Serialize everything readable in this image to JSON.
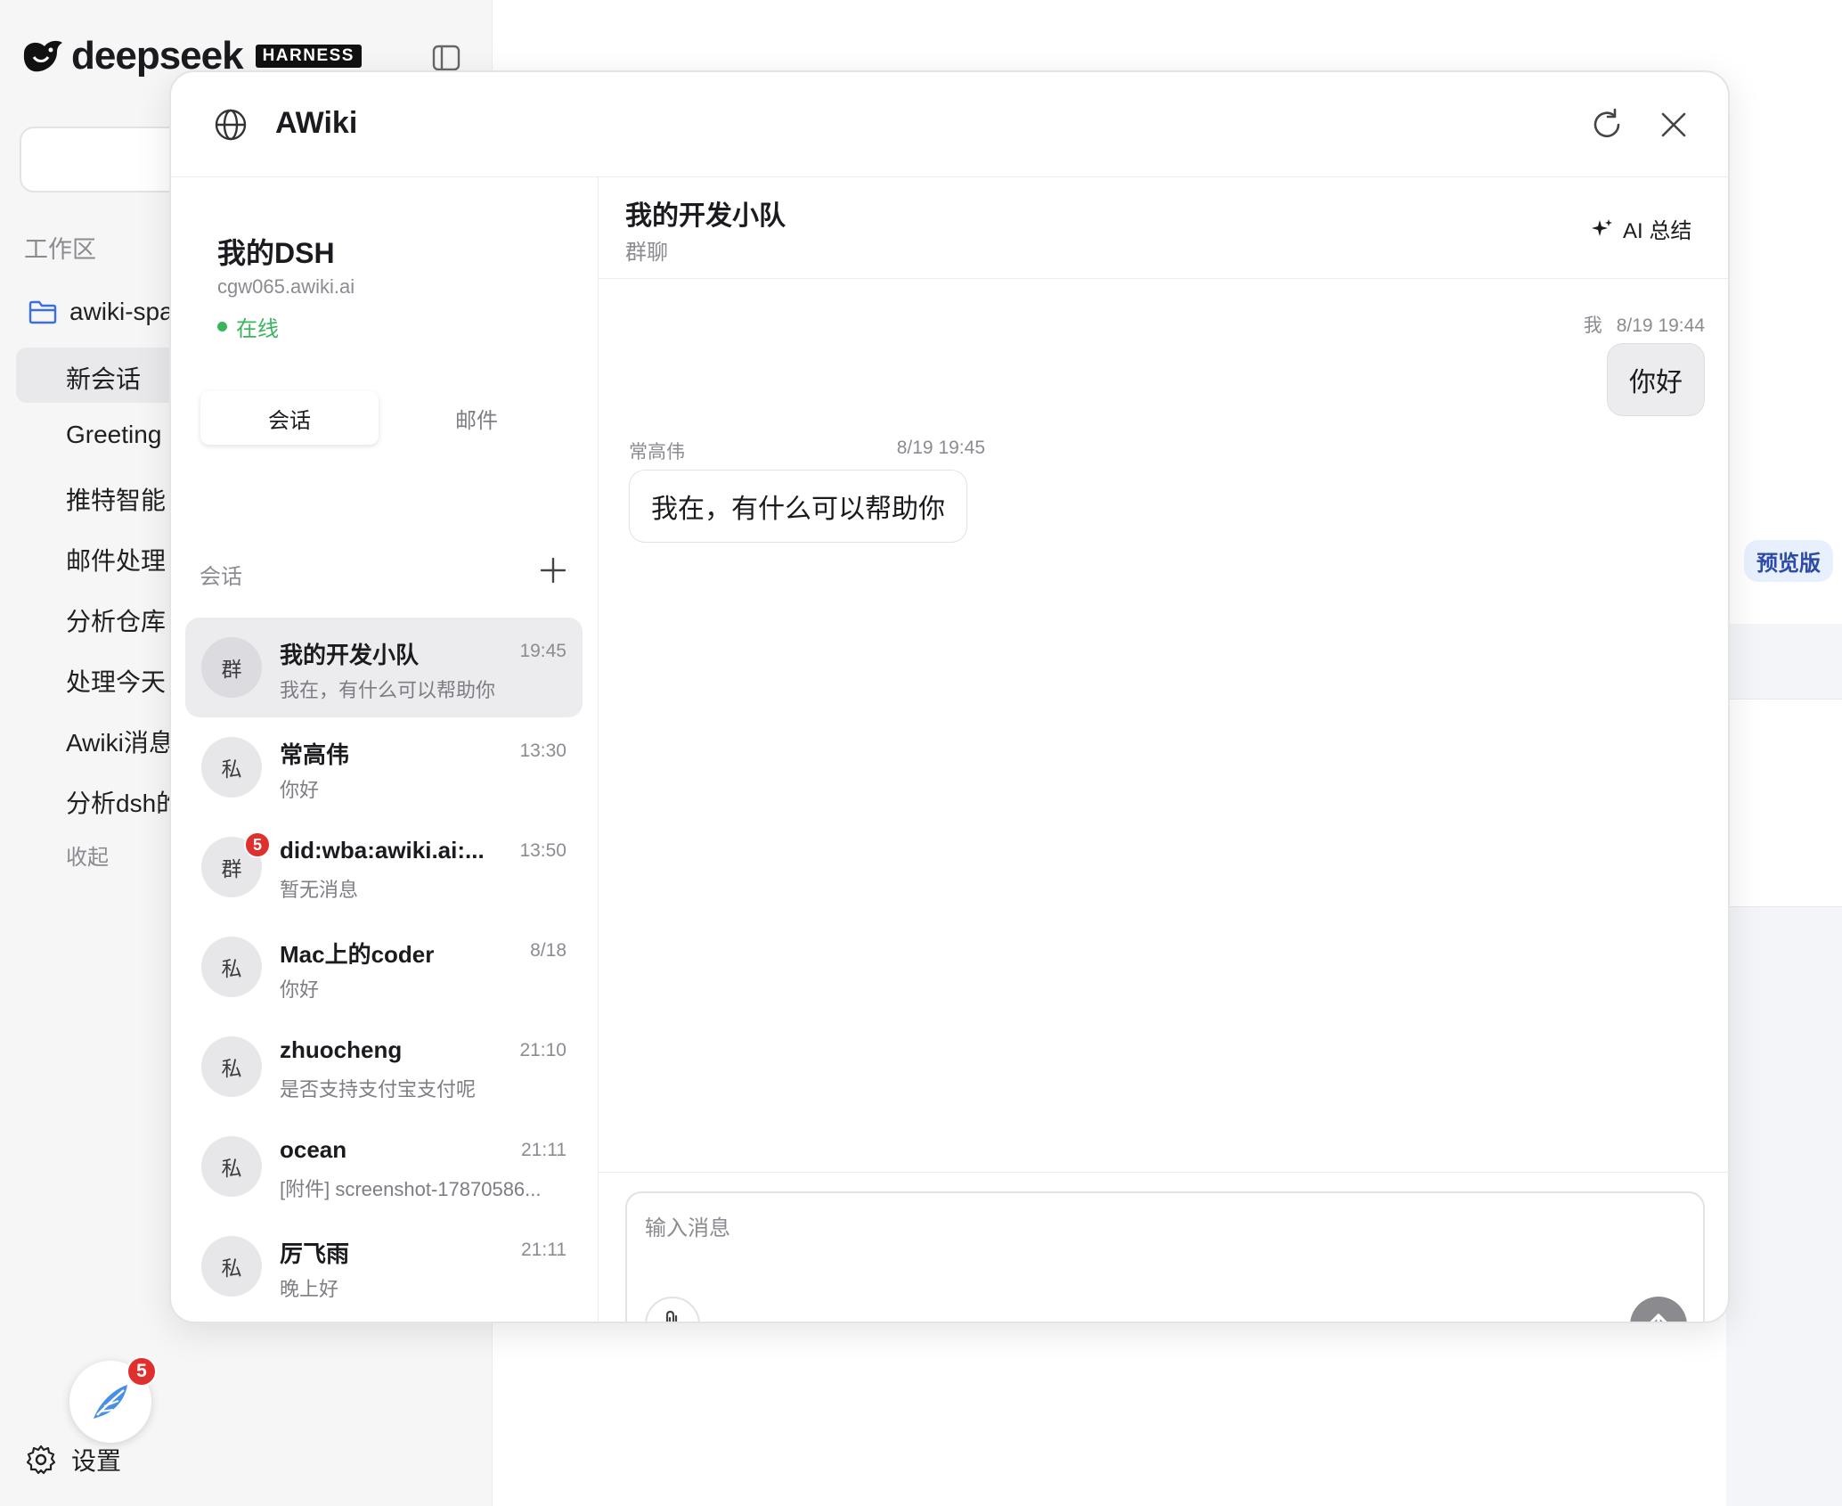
{
  "app": {
    "logo_text": "deepseek",
    "logo_badge": "HARNESS"
  },
  "sidebar": {
    "workspace_label": "工作区",
    "folder": "awiki-spa",
    "items": [
      {
        "label": "新会话"
      },
      {
        "label": "Greeting"
      },
      {
        "label": "推特智能"
      },
      {
        "label": "邮件处理"
      },
      {
        "label": "分析仓库"
      },
      {
        "label": "处理今天"
      },
      {
        "label": "Awiki消息"
      },
      {
        "label": "分析dsh的"
      }
    ],
    "collapse": "收起",
    "floating_badge": "5",
    "settings": "设置"
  },
  "background": {
    "preview_badge": "预览版"
  },
  "modal": {
    "title": "AWiki",
    "account": {
      "name": "我的DSH",
      "domain": "cgw065.awiki.ai",
      "status": "在线"
    },
    "tabs": [
      "会话",
      "邮件"
    ],
    "section_label": "会话",
    "conversations": [
      {
        "avatar": "群",
        "name": "我的开发小队",
        "time": "19:45",
        "preview": "我在，有什么可以帮助你",
        "badge": ""
      },
      {
        "avatar": "私",
        "name": "常高伟",
        "time": "13:30",
        "preview": "你好",
        "badge": ""
      },
      {
        "avatar": "群",
        "name": "did:wba:awiki.ai:...",
        "time": "13:50",
        "preview": "暂无消息",
        "badge": "5"
      },
      {
        "avatar": "私",
        "name": "Mac上的coder",
        "time": "8/18",
        "preview": "你好",
        "badge": ""
      },
      {
        "avatar": "私",
        "name": "zhuocheng",
        "time": "21:10",
        "preview": "是否支持支付宝支付呢",
        "badge": ""
      },
      {
        "avatar": "私",
        "name": "ocean",
        "time": "21:11",
        "preview": "[附件] screenshot-17870586...",
        "badge": ""
      },
      {
        "avatar": "私",
        "name": "厉飞雨",
        "time": "21:11",
        "preview": "晚上好",
        "badge": ""
      }
    ],
    "chat": {
      "title": "我的开发小队",
      "subtitle": "群聊",
      "ai_summary": "AI 总结",
      "messages": [
        {
          "sender": "我",
          "time": "8/19 19:44",
          "text": "你好"
        },
        {
          "sender": "常高伟",
          "time": "8/19 19:45",
          "text": "我在，有什么可以帮助你"
        }
      ],
      "composer_placeholder": "输入消息"
    }
  }
}
